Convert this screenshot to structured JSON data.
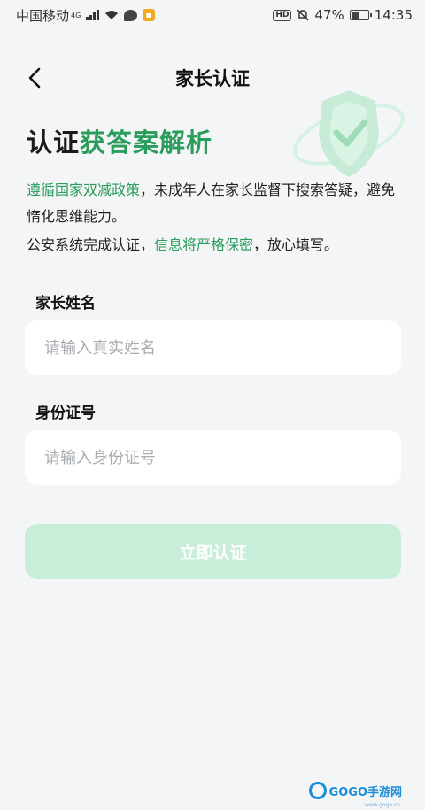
{
  "status_bar": {
    "carrier": "中国移动",
    "network": "4G",
    "battery": "47%",
    "time": "14:35",
    "hd_label": "HD"
  },
  "nav": {
    "title": "家长认证"
  },
  "headline": {
    "part1": "认证",
    "part2": "获答案解析"
  },
  "description": {
    "line1_highlight": "遵循国家双减政策",
    "line1_rest": "，未成年人在家长监督下搜索答疑，避免惰化思维能力。",
    "line2_start": "公安系统完成认证，",
    "line2_highlight": "信息将严格保密",
    "line2_end": "，放心填写。"
  },
  "form": {
    "name_label": "家长姓名",
    "name_placeholder": "请输入真实姓名",
    "name_value": "",
    "id_label": "身份证号",
    "id_placeholder": "请输入身份证号",
    "id_value": "",
    "submit_label": "立即认证"
  },
  "watermark": {
    "text": "GOGO手游网",
    "subtext": "www.gogo.cn"
  },
  "colors": {
    "accent": "#2a9d5c",
    "button_disabled": "#c8eed9",
    "background": "#f4f5f7"
  }
}
